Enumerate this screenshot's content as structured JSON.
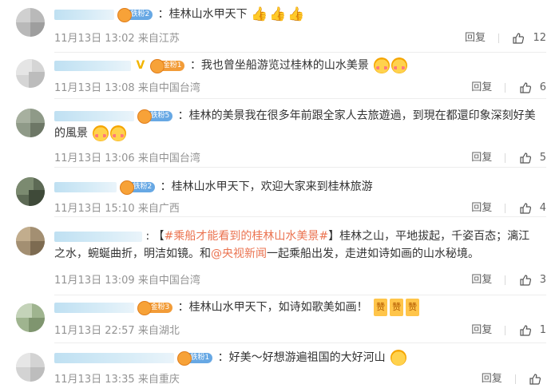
{
  "comments": [
    {
      "badge": "铁粉2",
      "badge_color": "blue",
      "segments": [
        {
          "t": "：桂林山水甲天下"
        }
      ],
      "thumbs": "👍👍👍",
      "time": "11月13日 13:02",
      "location": "来自江苏",
      "reply": "回复",
      "likes": "12"
    },
    {
      "badge": "金粉1",
      "badge_color": "gold",
      "segments": [
        {
          "t": "：我也曾坐船游览过桂林的山水美景"
        }
      ],
      "time": "11月13日 13:08",
      "location": "来自中国台湾",
      "reply": "回复",
      "likes": "6"
    },
    {
      "badge": "铁粉5",
      "badge_color": "blue",
      "line1": "：桂林的美景我在很多年前跟全家人去旅遊過，到現在都還印象深刻好美",
      "line2": "的風景",
      "time": "11月13日 13:06",
      "location": "来自中国台湾",
      "reply": "回复",
      "likes": "5"
    },
    {
      "badge": "铁粉2",
      "badge_color": "blue",
      "segments": [
        {
          "t": "：桂林山水甲天下，欢迎大家来到桂林旅游"
        }
      ],
      "time": "11月13日 15:10",
      "location": "来自广西",
      "reply": "回复",
      "likes": "4"
    },
    {
      "line1_prefix": ": 【",
      "topic": "#乘船才能看到的桂林山水美景#",
      "line1_suffix": "】桂林之山，平地拔起，千姿百态；漓江",
      "line2_prefix": "之水，蜿蜒曲折，明洁如镜。和",
      "mention": "@央视新闻",
      "line2_suffix": "一起乘船出发，走进如诗如画的山水秘境。",
      "time": "11月13日 13:09",
      "location": "来自中国台湾",
      "reply": "回复",
      "likes": "3"
    },
    {
      "badge": "金粉3",
      "badge_color": "gold",
      "segments": [
        {
          "t": "：桂林山水甲天下，如诗如歌美如画！"
        }
      ],
      "zan": [
        "赞",
        "赞",
        "赞"
      ],
      "time": "11月13日 22:57",
      "location": "来自湖北",
      "reply": "回复",
      "likes": "1"
    },
    {
      "badge": "铁粉1",
      "badge_color": "blue",
      "segments": [
        {
          "t": "：好美～好想游遍祖国的大好河山"
        }
      ],
      "time": "11月13日 13:35",
      "location": "来自重庆",
      "reply": "回复",
      "likes": ""
    }
  ],
  "colors": {
    "link": "#eb7350",
    "meta": "#939393",
    "badge_blue": "#67a8e4",
    "badge_gold": "#f29c38"
  }
}
